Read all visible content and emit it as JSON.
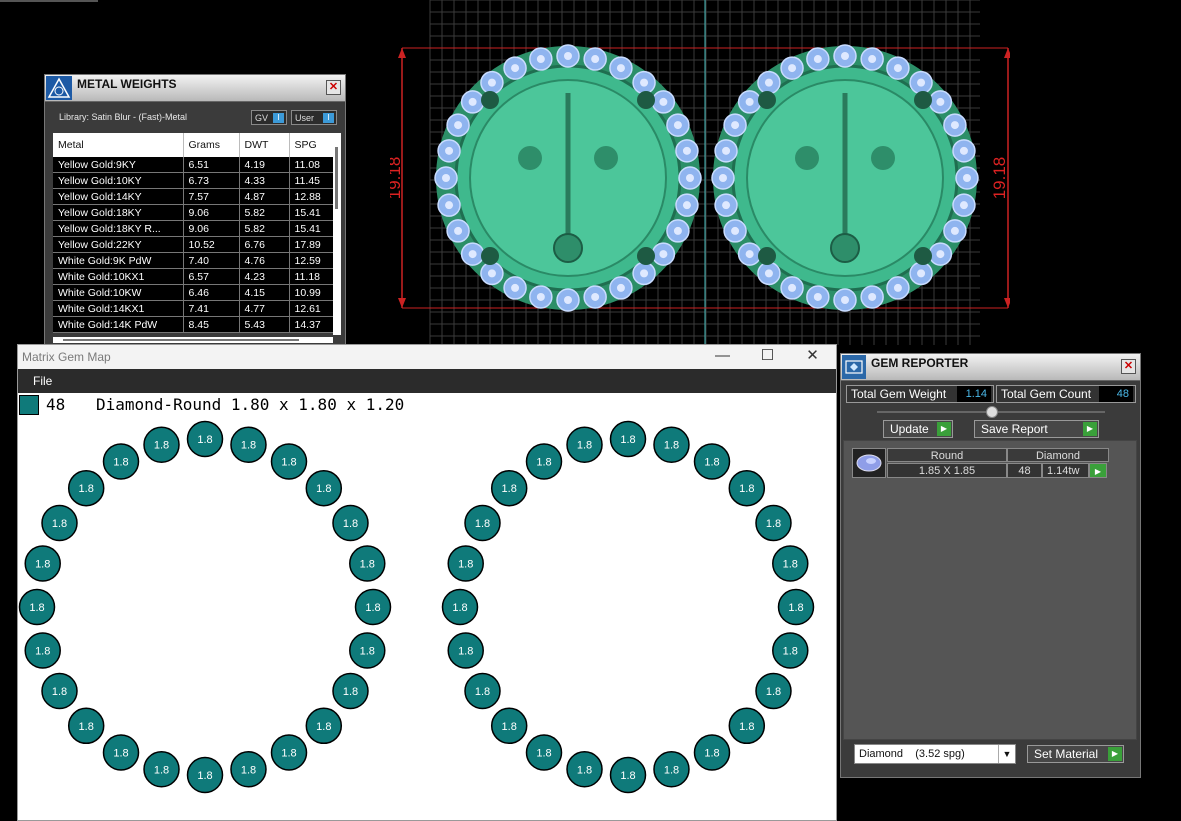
{
  "viewport": {
    "dim_left": "19.18",
    "dim_right": "19.18"
  },
  "metal_weights": {
    "title": "METAL WEIGHTS",
    "library": "Library: Satin Blur - (Fast)-Metal",
    "toggle_gv": "GV",
    "toggle_user": "User",
    "columns": [
      "Metal",
      "Grams",
      "DWT",
      "SPG"
    ],
    "rows": [
      [
        "Yellow Gold:9KY",
        "6.51",
        "4.19",
        "11.08"
      ],
      [
        "Yellow Gold:10KY",
        "6.73",
        "4.33",
        "11.45"
      ],
      [
        "Yellow Gold:14KY",
        "7.57",
        "4.87",
        "12.88"
      ],
      [
        "Yellow Gold:18KY",
        "9.06",
        "5.82",
        "15.41"
      ],
      [
        "Yellow Gold:18KY R...",
        "9.06",
        "5.82",
        "15.41"
      ],
      [
        "Yellow Gold:22KY",
        "10.52",
        "6.76",
        "17.89"
      ],
      [
        "White Gold:9K PdW",
        "7.40",
        "4.76",
        "12.59"
      ],
      [
        "White Gold:10KX1",
        "6.57",
        "4.23",
        "11.18"
      ],
      [
        "White Gold:10KW",
        "6.46",
        "4.15",
        "10.99"
      ],
      [
        "White Gold:14KX1",
        "7.41",
        "4.77",
        "12.61"
      ],
      [
        "White Gold:14K PdW",
        "8.45",
        "5.43",
        "14.37"
      ]
    ]
  },
  "gem_map": {
    "title": "Matrix Gem Map",
    "menu_file": "File",
    "legend_count": "48",
    "legend_text": "Diamond-Round 1.80 x 1.80 x 1.20",
    "gem_label": "1.8",
    "gems_per_ring": 24,
    "gem_color": "#0f7a7a"
  },
  "gem_reporter": {
    "title": "GEM REPORTER",
    "total_weight_label": "Total Gem Weight",
    "total_weight_value": "1.14",
    "total_count_label": "Total Gem Count",
    "total_count_value": "48",
    "update_label": "Update",
    "save_label": "Save Report",
    "hdr_shape": "Round",
    "hdr_material": "Diamond",
    "size": "1.85 X 1.85",
    "count": "48",
    "weight": "1.14tw",
    "material_select": "Diamond    (3.52 spg)",
    "set_material_label": "Set Material"
  }
}
